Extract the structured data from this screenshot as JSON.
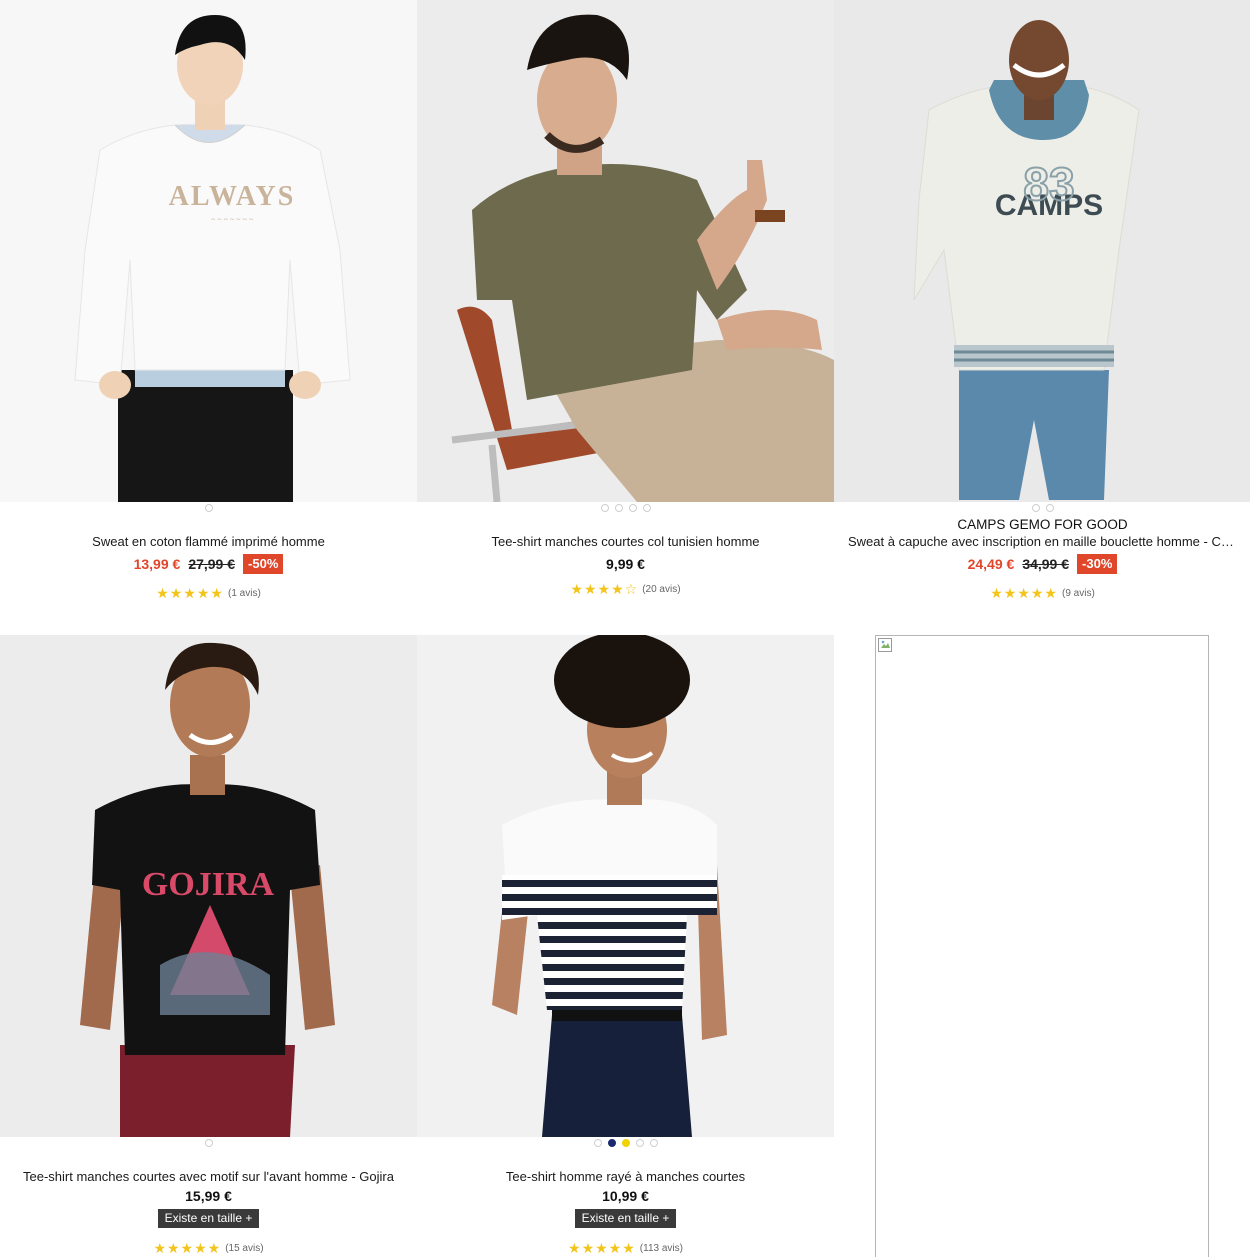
{
  "products": [
    {
      "brand": "",
      "title": "Sweat en coton flammé imprimé homme",
      "price": "13,99 €",
      "old_price": "27,99 €",
      "discount": "-50%",
      "rating_stars": "★★★★★",
      "rating": 5,
      "reviews": "(1 avis)",
      "print_text": "ALWAYS"
    },
    {
      "brand": "",
      "title": "Tee-shirt manches courtes col tunisien homme",
      "price": "9,99 €",
      "rating_stars": "★★★★☆",
      "rating": 4.5,
      "reviews": "(20 avis)"
    },
    {
      "brand": "CAMPS GEMO FOR GOOD",
      "title": "Sweat à capuche avec inscription en maille bouclette homme - Ca...",
      "price": "24,49 €",
      "old_price": "34,99 €",
      "discount": "-30%",
      "rating_stars": "★★★★★",
      "rating": 5,
      "reviews": "(9 avis)",
      "print_text": "CAMPS"
    },
    {
      "brand": "",
      "title": "Tee-shirt manches courtes avec motif sur l'avant homme - Gojira",
      "price": "15,99 €",
      "size_button": "Existe en taille +",
      "rating_stars": "★★★★★",
      "rating": 5,
      "reviews": "(15 avis)",
      "print_text": "GOJIRA"
    },
    {
      "brand": "",
      "title": "Tee-shirt homme rayé à manches courtes",
      "price": "10,99 €",
      "size_button": "Existe en taille +",
      "rating_stars": "★★★★★",
      "rating": 5,
      "reviews": "(113 avis)"
    }
  ],
  "colors": {
    "sale": "#e0462a",
    "star": "#f3c41a",
    "size_button_bg": "#3a3a3a",
    "swatch_navy": "#1b2a6e",
    "swatch_yellow": "#f2d200"
  }
}
